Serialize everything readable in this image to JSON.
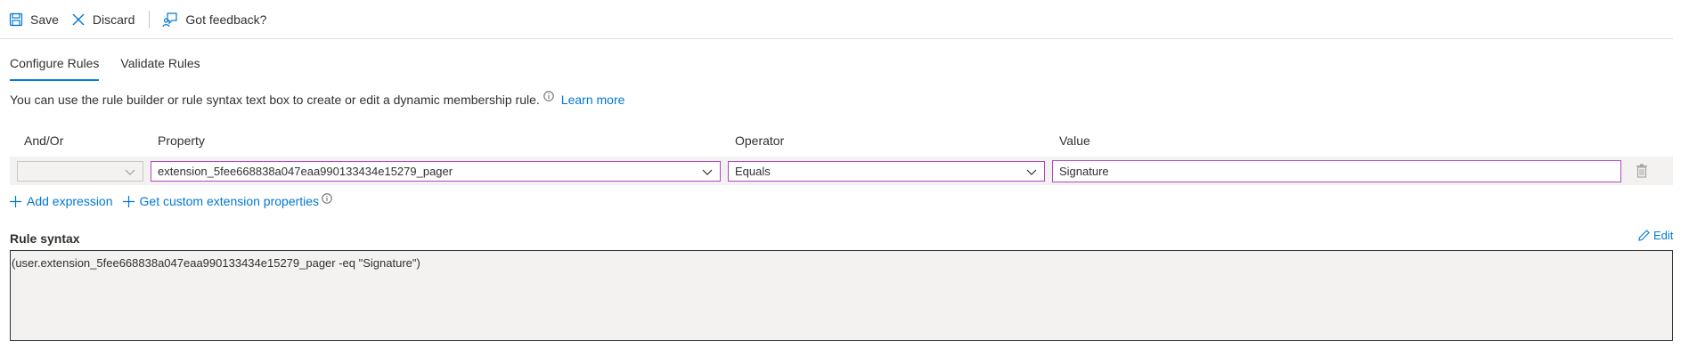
{
  "toolbar": {
    "save_label": "Save",
    "discard_label": "Discard",
    "feedback_label": "Got feedback?"
  },
  "tabs": [
    {
      "label": "Configure Rules",
      "active": true
    },
    {
      "label": "Validate Rules",
      "active": false
    }
  ],
  "description": {
    "text": "You can use the rule builder or rule syntax text box to create or edit a dynamic membership rule.",
    "learn_more": "Learn more"
  },
  "columns": {
    "and_or": "And/Or",
    "property": "Property",
    "operator": "Operator",
    "value": "Value"
  },
  "rule": {
    "and_or": "",
    "property": "extension_5fee668838a047eaa990133434e15279_pager",
    "operator": "Equals",
    "value": "Signature"
  },
  "actions": {
    "add_expression": "Add expression",
    "get_custom_extension": "Get custom extension properties"
  },
  "rule_syntax": {
    "label": "Rule syntax",
    "edit_label": "Edit",
    "text": "(user.extension_5fee668838a047eaa990133434e15279_pager -eq \"Signature\")"
  },
  "colors": {
    "accent": "#0078d4",
    "focus_border": "#b146c2"
  }
}
